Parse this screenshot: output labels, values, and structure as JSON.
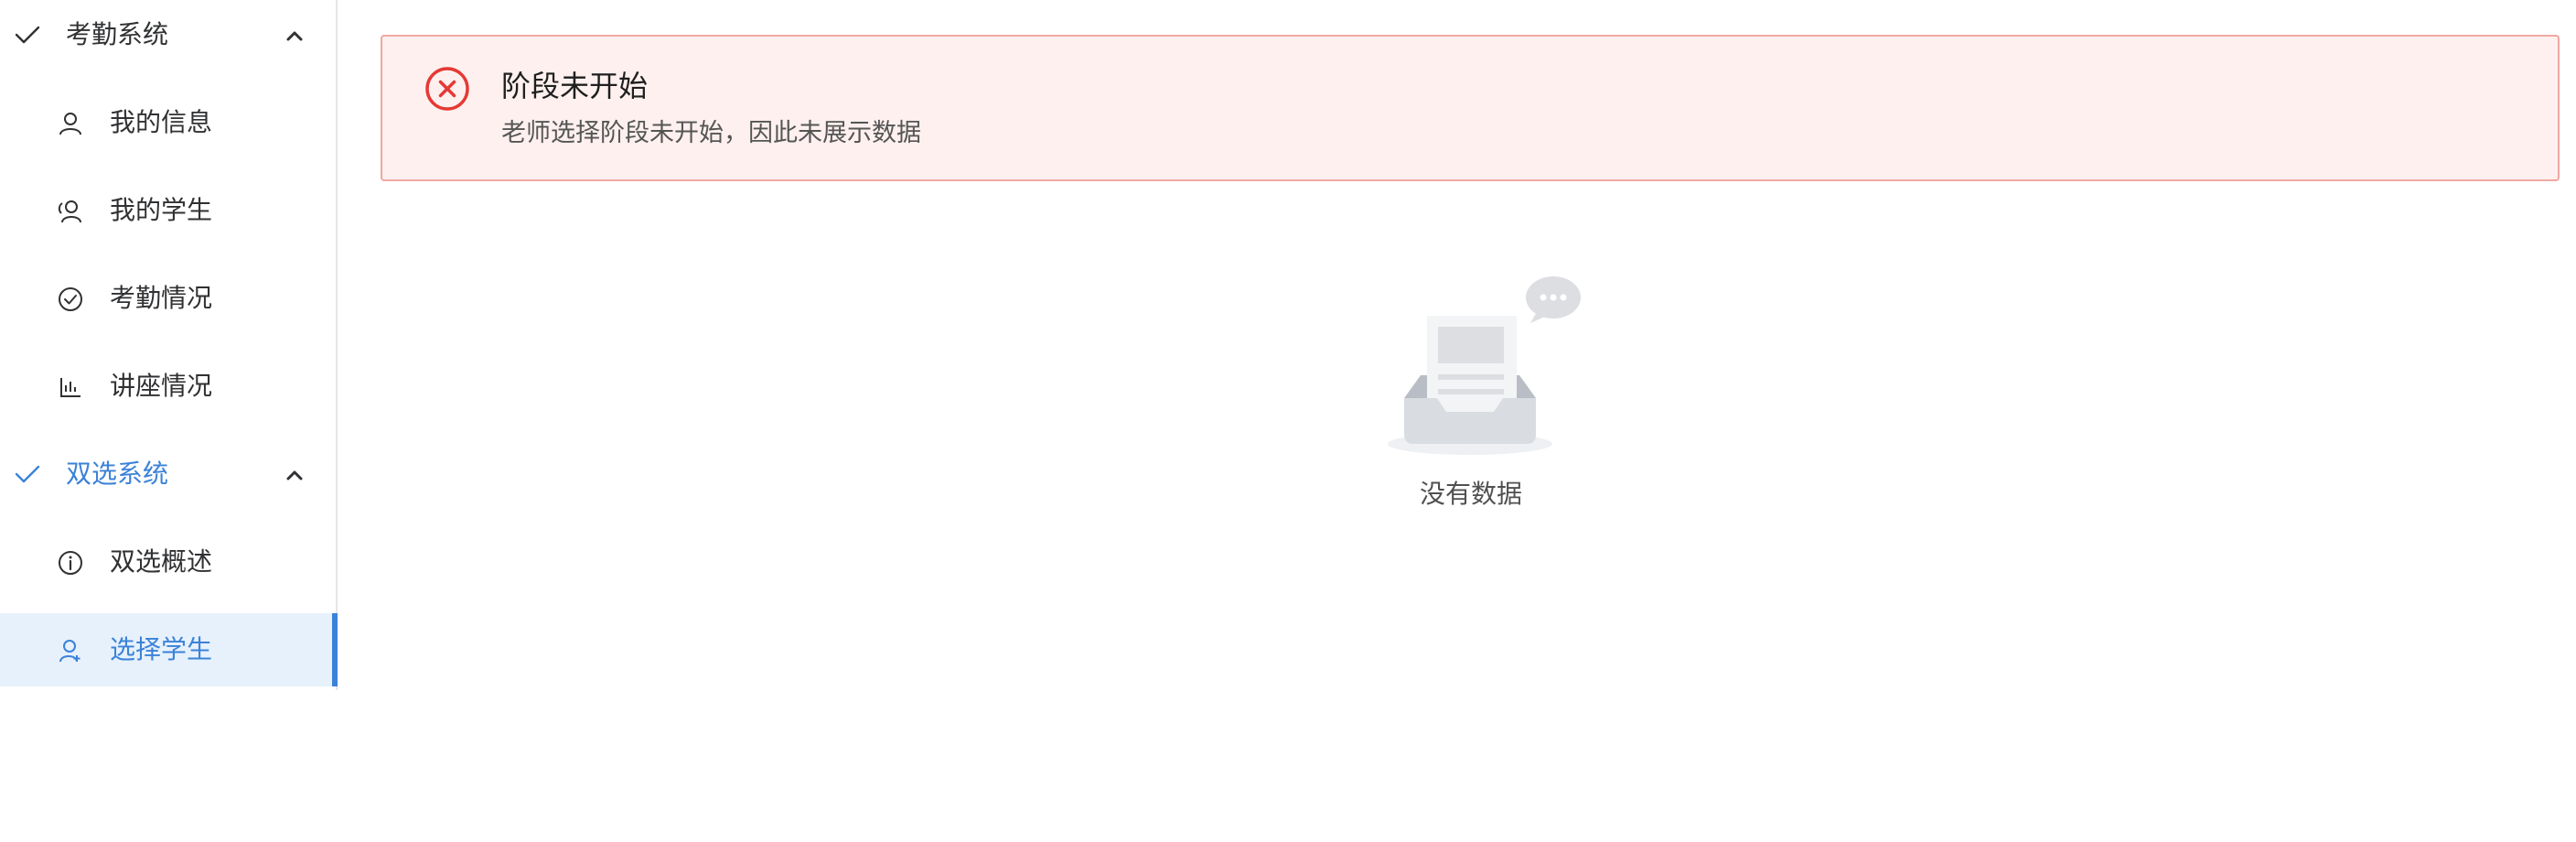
{
  "sidebar": {
    "groups": [
      {
        "title": "考勤系统",
        "items": [
          {
            "label": "我的信息",
            "icon": "user-icon"
          },
          {
            "label": "我的学生",
            "icon": "users-icon"
          },
          {
            "label": "考勤情况",
            "icon": "check-circle-icon"
          },
          {
            "label": "讲座情况",
            "icon": "bar-chart-icon"
          }
        ]
      },
      {
        "title": "双选系统",
        "items": [
          {
            "label": "双选概述",
            "icon": "info-icon"
          },
          {
            "label": "选择学生",
            "icon": "users-icon"
          }
        ]
      }
    ],
    "active_item": "选择学生"
  },
  "alert": {
    "title": "阶段未开始",
    "description": "老师选择阶段未开始，因此未展示数据",
    "icon": "error-circle-icon",
    "color": "#e53935"
  },
  "empty": {
    "text": "没有数据",
    "icon": "empty-inbox-icon"
  },
  "colors": {
    "accent": "#3b82d8",
    "alert_bg": "#fdf0ef",
    "alert_border": "#f1a7a2"
  }
}
